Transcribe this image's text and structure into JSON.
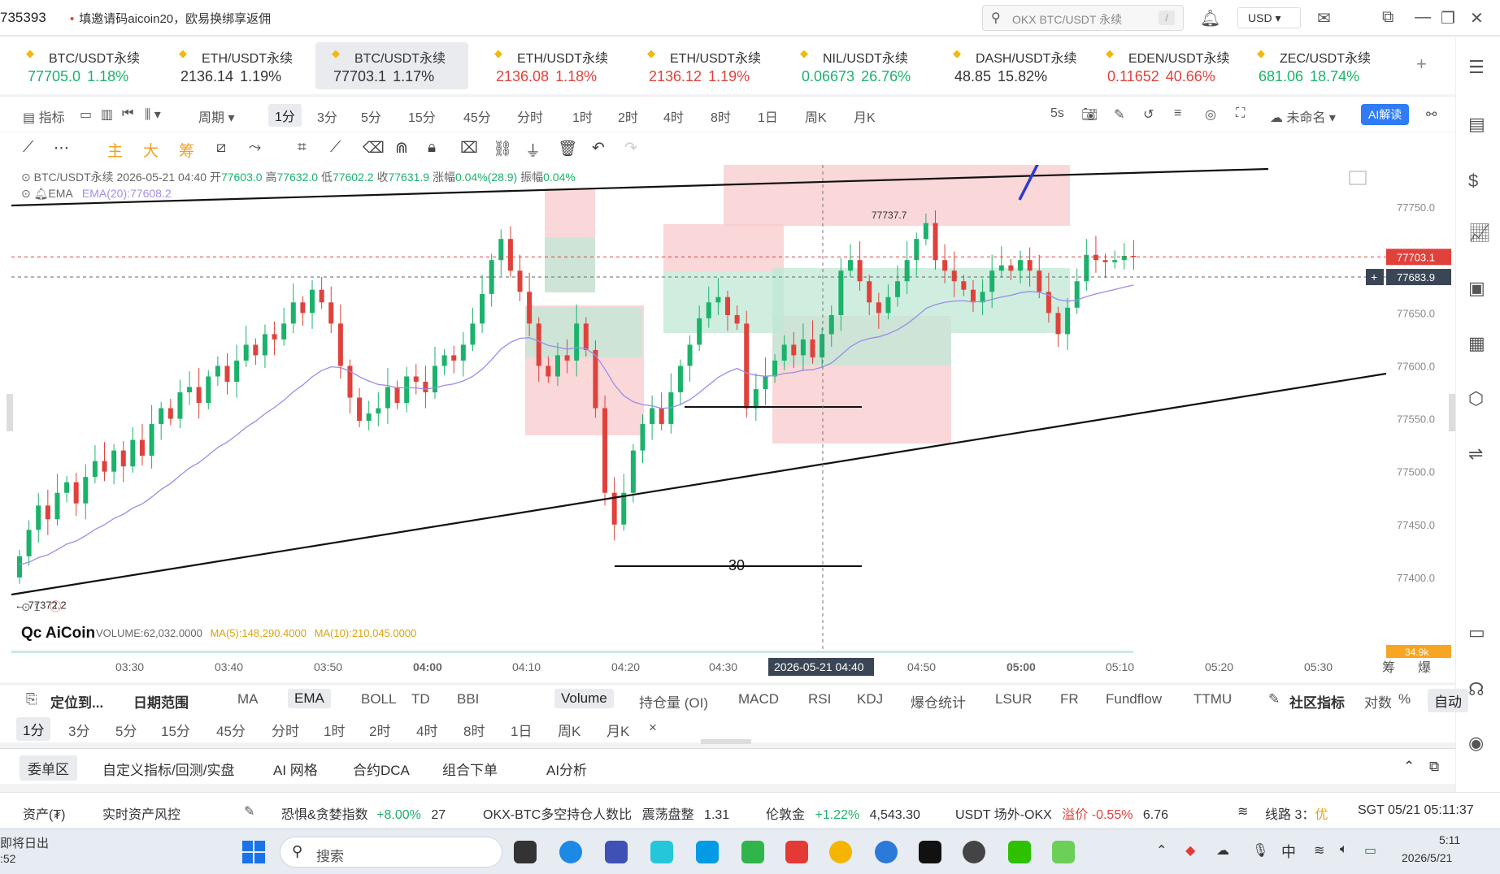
{
  "topbar": {
    "app_id": "735393",
    "promo": "填邀请码aicoin20，欧易换绑享返佣",
    "search_placeholder": "OKX BTC/USDT 永续",
    "search_shortcut": "/",
    "currency": "USD"
  },
  "tickers": [
    {
      "name": "BTC/USDT永续",
      "price": "77705.0",
      "change": "1.18%",
      "trend": "up"
    },
    {
      "name": "ETH/USDT永续",
      "price": "2136.14",
      "change": "1.19%",
      "trend": "flat"
    },
    {
      "name": "BTC/USDT永续",
      "price": "77703.1",
      "change": "1.17%",
      "trend": "flat",
      "active": true
    },
    {
      "name": "ETH/USDT永续",
      "price": "2136.08",
      "change": "1.18%",
      "trend": "down"
    },
    {
      "name": "ETH/USDT永续",
      "price": "2136.12",
      "change": "1.19%",
      "trend": "down"
    },
    {
      "name": "NIL/USDT永续",
      "price": "0.06673",
      "change": "26.76%",
      "trend": "up"
    },
    {
      "name": "DASH/USDT永续",
      "price": "48.85",
      "change": "15.82%",
      "trend": "flat"
    },
    {
      "name": "EDEN/USDT永续",
      "price": "0.11652",
      "change": "40.66%",
      "trend": "down"
    },
    {
      "name": "ZEC/USDT永续",
      "price": "681.06",
      "change": "18.74%",
      "trend": "up"
    }
  ],
  "toolbar": {
    "indicator": "指标",
    "period": "周期",
    "timeframes": [
      "1分",
      "3分",
      "5分",
      "15分",
      "45分",
      "分时",
      "1时",
      "2时",
      "4时",
      "8时",
      "1日",
      "周K",
      "月K"
    ],
    "selected_tf": "1分",
    "refresh": "5s",
    "unnamed": "未命名",
    "ai_label": "AI解读"
  },
  "drawtools": {
    "main": "主",
    "big": "大",
    "chip": "筹"
  },
  "legend": {
    "symbol": "BTC/USDT永续",
    "datetime": "2026-05-21 04:40",
    "open_label": "开",
    "open": "77603.0",
    "high_label": "高",
    "high": "77632.0",
    "low_label": "低",
    "low": "77602.2",
    "close_label": "收",
    "close": "77631.9",
    "chg_label": "涨幅",
    "chg": "0.04%(28.9)",
    "amp_label": "振幅",
    "amp": "0.04%",
    "ema_name": "EMA",
    "ema_value": "EMA(20):77608.2",
    "sub_index": "1"
  },
  "volume_legend": {
    "volume": "VOLUME:62,032.0000",
    "ma5": "MA(5):148,290.4000",
    "ma10": "MA(10):210,045.0000",
    "right_tag": "34.9k"
  },
  "chart_data": {
    "type": "candlestick",
    "title": "BTC/USDT永续 1分",
    "y_ticks": [
      "77750.0",
      "77700.0",
      "77650.0",
      "77600.0",
      "77550.0",
      "77500.0",
      "77450.0",
      "77400.0"
    ],
    "ylim": [
      77360,
      77790
    ],
    "x_ticks": [
      "03:30",
      "03:40",
      "03:50",
      "04:00",
      "04:10",
      "04:20",
      "04:30",
      "04:40",
      "04:50",
      "05:00",
      "05:10",
      "05:20",
      "05:30"
    ],
    "crosshair_time": "2026-05-21 04:40",
    "last_price": "77703.1",
    "crosshair_price": "77683.9",
    "low_marker": "77372.2",
    "high_marker": "77737.7",
    "annotation": "30",
    "ema_name": "EMA(20)"
  },
  "indicators": {
    "locate": "定位到...",
    "date_range": "日期范围",
    "main_ind": [
      "MA",
      "EMA",
      "BOLL",
      "TD",
      "BBI"
    ],
    "sub_ind": [
      "Volume",
      "持仓量 (OI)",
      "MACD",
      "RSI",
      "KDJ",
      "爆仓统计",
      "LSUR",
      "FR",
      "Fundflow",
      "TTMU"
    ],
    "community": "社区指标",
    "log": "对数",
    "pct": "%",
    "auto": "自动",
    "chip": "筹",
    "blast": "爆"
  },
  "tf_bar": [
    "1分",
    "3分",
    "5分",
    "15分",
    "45分",
    "分时",
    "1时",
    "2时",
    "4时",
    "8时",
    "1日",
    "周K",
    "月K"
  ],
  "bottom_tabs": [
    "委单区",
    "自定义指标/回测/实盘",
    "AI 网格",
    "合约DCA",
    "组合下单",
    "AI分析"
  ],
  "status": {
    "assets": "资产(₮)",
    "risk": "实时资产风控",
    "fear_label": "恐惧&贪婪指数",
    "fear_change": "+8.00%",
    "fear_value": "27",
    "ratio_label": "OKX-BTC多空持仓人数比",
    "ratio_state": "震荡盘整",
    "ratio_value": "1.31",
    "gold_label": "伦敦金",
    "gold_change": "+1.22%",
    "gold_value": "4,543.30",
    "usdt_label": "USDT 场外-OKX",
    "usdt_prem": "溢价 -0.55%",
    "usdt_value": "6.76",
    "route": "线路 3：",
    "route_q": "优",
    "clock": "SGT 05/21 05:11:37"
  },
  "taskbar": {
    "weather": "即将日出",
    "weather2": ":52",
    "search": "搜索",
    "ime": "中",
    "time": "5:11",
    "date": "2026/5/21"
  }
}
